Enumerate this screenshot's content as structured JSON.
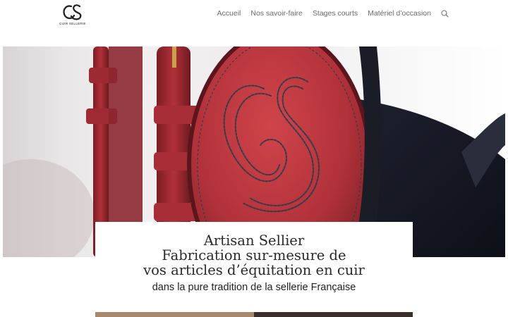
{
  "logo": {
    "monogram": "CS",
    "subtitle": "CUIR SELLERIE"
  },
  "nav": {
    "items": [
      {
        "label": "Accueil"
      },
      {
        "label": "Nos savoir-faire"
      },
      {
        "label": "Stages courts"
      },
      {
        "label": "Matériel d’occasion"
      }
    ],
    "search_icon": "search-icon"
  },
  "hero": {
    "image": "red-leather-bridle-with-cs-monogram"
  },
  "card": {
    "title_line1": "Artisan Sellier",
    "title_line2": "Fabrication sur-mesure de",
    "title_line3": "vos articles d’équitation en cuir",
    "subtitle": "dans la pure tradition de la sellerie Française"
  },
  "colors": {
    "leather_red": "#b8343a",
    "leather_dark": "#5c1d22",
    "stitch": "#3a3a48"
  }
}
